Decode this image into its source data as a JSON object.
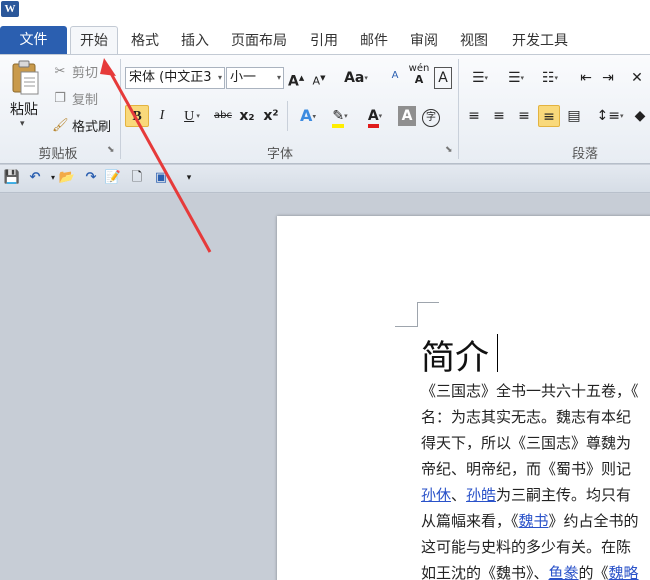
{
  "app": {
    "logo_letter": "W"
  },
  "tabs": {
    "file": "文件",
    "items": [
      "开始",
      "格式",
      "插入",
      "页面布局",
      "引用",
      "邮件",
      "审阅",
      "视图",
      "开发工具"
    ]
  },
  "clipboard": {
    "paste": "粘贴",
    "cut": "剪切",
    "copy": "复制",
    "format_painter": "格式刷",
    "group_label": "剪贴板"
  },
  "font": {
    "font_name": "宋体 (中文正3",
    "font_size": "小一",
    "group_label": "字体",
    "case_label": "Aa",
    "bold": "B",
    "italic": "I",
    "underline": "U",
    "strike": "abc",
    "sub": "x₂",
    "sup": "x²",
    "grow": "A",
    "shrink": "A",
    "clear_label": "A",
    "phonetic": "wén",
    "char_border": "A",
    "shade": "A",
    "enclose": "字"
  },
  "paragraph": {
    "group_label": "段落"
  },
  "document": {
    "title": "简介",
    "lines": [
      "《三国志》全书一共六十五卷，《",
      "名：为志其实无志。魏志有本纪",
      "得天下，所以《三国志》尊魏为",
      "帝纪、明帝纪，而《蜀书》则记",
      "为三嗣主传。均只有",
      "从篇幅来看，《魏书》约占全书的",
      "这可能与史料的多少有关。在陈",
      "如王沈的《魏书》、鱼豢的《魏略"
    ],
    "line5_link1": "孙休",
    "line5_sep": "、",
    "line5_link2": "孙皓",
    "line6_pre": "从篇幅来看，《",
    "line6_link": "魏书",
    "line6_post": "》约占全书的",
    "line8_pre": "如王沈的《魏书》、",
    "line8_link1": "鱼豢",
    "line8_mid": "的《",
    "line8_link2": "魏略"
  },
  "colors": {
    "file_tab": "#2b5fb0",
    "bold_highlight": "#f9d97b",
    "link": "#2a52c9",
    "arrow": "#e63a3a"
  }
}
